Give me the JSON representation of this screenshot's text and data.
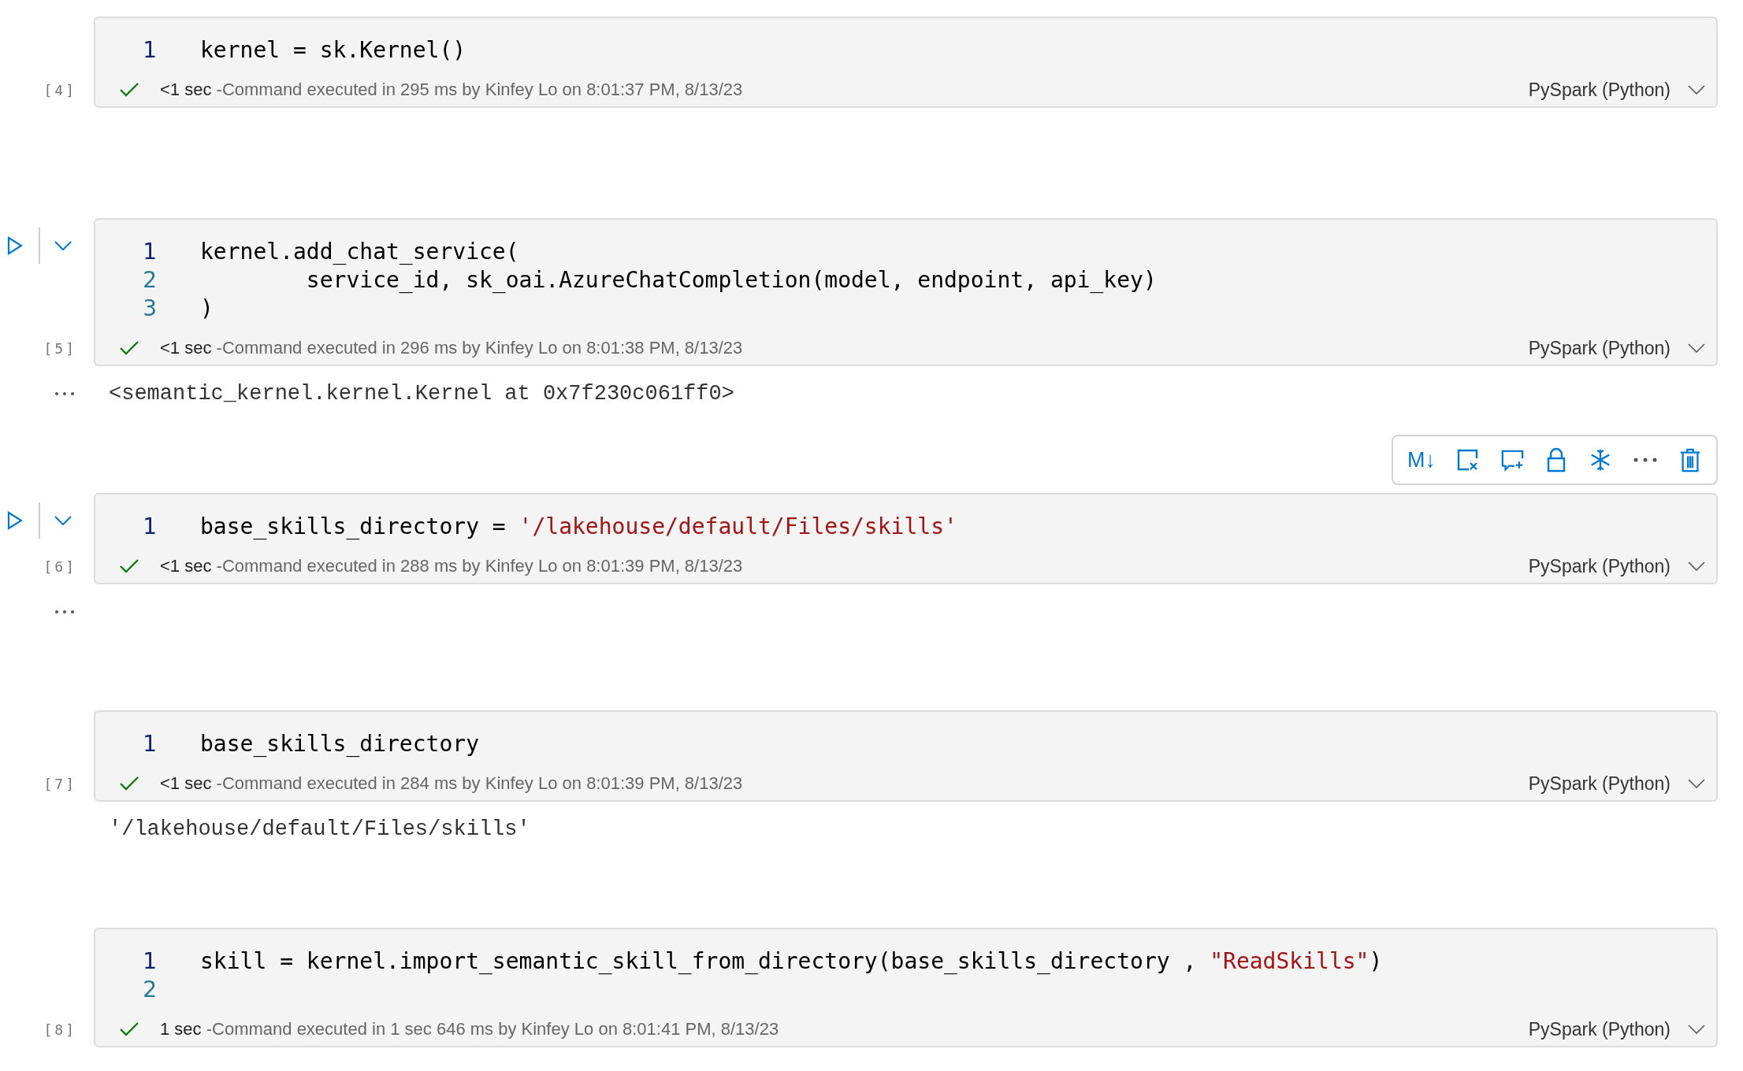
{
  "cells": [
    {
      "focused": false,
      "count": "[4]",
      "lines": [
        {
          "number": "1",
          "current": true,
          "tokens": [
            {
              "kind": "code",
              "text": "kernel = sk.Kernel()"
            }
          ]
        }
      ],
      "status": {
        "succeeded": true,
        "duration": "<1 sec",
        "detail": "-Command executed in 295 ms by Kinfey Lo on 8:01:37 PM, 8/13/23",
        "language": "PySpark (Python)"
      }
    },
    {
      "focused": true,
      "count": "[5]",
      "lines": [
        {
          "number": "1",
          "current": true,
          "tokens": [
            {
              "kind": "code",
              "text": "kernel.add_chat_service("
            }
          ]
        },
        {
          "number": "2",
          "current": false,
          "tokens": [
            {
              "kind": "code",
              "text": "        service_id, sk_oai.AzureChatCompletion(model, endpoint, api_key)"
            }
          ]
        },
        {
          "number": "3",
          "current": false,
          "tokens": [
            {
              "kind": "code",
              "text": ")"
            }
          ]
        }
      ],
      "status": {
        "succeeded": true,
        "duration": "<1 sec",
        "detail": "-Command executed in 296 ms by Kinfey Lo on 8:01:38 PM, 8/13/23",
        "language": "PySpark (Python)"
      },
      "output": {
        "collapsible": true,
        "text": "<semantic_kernel.kernel.Kernel at 0x7f230c061ff0>"
      }
    },
    {
      "focused": true,
      "toolbar": {
        "markdown_label": "M↓"
      },
      "count": "[6]",
      "lines": [
        {
          "number": "1",
          "current": true,
          "tokens": [
            {
              "kind": "code",
              "text": "base_skills_directory = "
            },
            {
              "kind": "string",
              "text": "'/lakehouse/default/Files/skills'"
            }
          ]
        }
      ],
      "status": {
        "succeeded": true,
        "duration": "<1 sec",
        "detail": "-Command executed in 288 ms by Kinfey Lo on 8:01:39 PM, 8/13/23",
        "language": "PySpark (Python)"
      },
      "output": {
        "collapsible": true
      }
    },
    {
      "focused": false,
      "count": "[7]",
      "lines": [
        {
          "number": "1",
          "current": true,
          "tokens": [
            {
              "kind": "code",
              "text": "base_skills_directory"
            }
          ]
        }
      ],
      "status": {
        "succeeded": true,
        "duration": "<1 sec",
        "detail": "-Command executed in 284 ms by Kinfey Lo on 8:01:39 PM, 8/13/23",
        "language": "PySpark (Python)"
      },
      "output": {
        "collapsible": false,
        "text": "'/lakehouse/default/Files/skills'"
      }
    },
    {
      "focused": false,
      "count": "[8]",
      "lines": [
        {
          "number": "1",
          "current": true,
          "tokens": [
            {
              "kind": "code",
              "text": "skill = kernel.import_semantic_skill_from_directory(base_skills_directory , "
            },
            {
              "kind": "string",
              "text": "\"ReadSkills\""
            },
            {
              "kind": "code",
              "text": ")"
            }
          ]
        },
        {
          "number": "2",
          "current": false
        }
      ],
      "status": {
        "succeeded": true,
        "duration": "1 sec",
        "detail": "-Command executed in 1 sec 646 ms by Kinfey Lo on 8:01:41 PM, 8/13/23",
        "language": "PySpark (Python)"
      }
    }
  ]
}
